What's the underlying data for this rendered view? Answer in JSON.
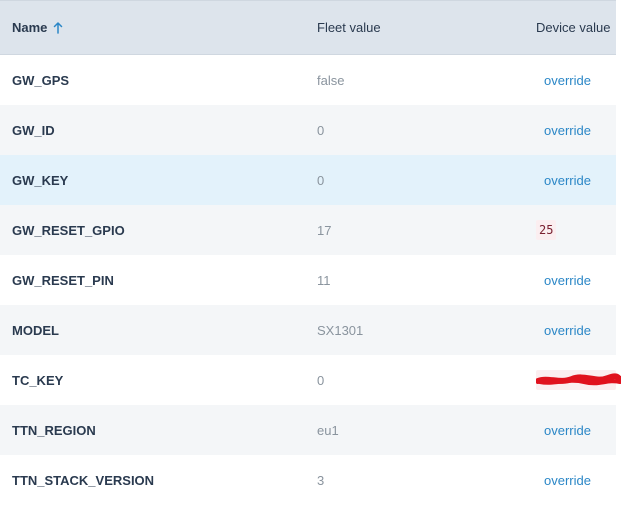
{
  "table": {
    "headers": {
      "name": "Name",
      "fleet_value": "Fleet value",
      "device_value": "Device value"
    },
    "sort_icon": "arrow-up-icon",
    "rows": [
      {
        "name": "GW_GPS",
        "fleet_value": "false",
        "device_value": "override",
        "device_type": "link"
      },
      {
        "name": "GW_ID",
        "fleet_value": "0",
        "device_value": "override",
        "device_type": "link"
      },
      {
        "name": "GW_KEY",
        "fleet_value": "0",
        "device_value": "override",
        "device_type": "link"
      },
      {
        "name": "GW_RESET_GPIO",
        "fleet_value": "17",
        "device_value": "25",
        "device_type": "value"
      },
      {
        "name": "GW_RESET_PIN",
        "fleet_value": "11",
        "device_value": "override",
        "device_type": "link"
      },
      {
        "name": "MODEL",
        "fleet_value": "SX1301",
        "device_value": "override",
        "device_type": "link"
      },
      {
        "name": "TC_KEY",
        "fleet_value": "0",
        "device_value": "",
        "device_type": "redacted"
      },
      {
        "name": "TTN_REGION",
        "fleet_value": "eu1",
        "device_value": "override",
        "device_type": "link"
      },
      {
        "name": "TTN_STACK_VERSION",
        "fleet_value": "3",
        "device_value": "override",
        "device_type": "link"
      }
    ]
  },
  "colors": {
    "header_bg": "#dde4ec",
    "row_alt_bg": "#f4f6f8",
    "row_highlight_bg": "#e3f2fb",
    "link": "#2b87c7",
    "redaction": "#e0121e"
  }
}
